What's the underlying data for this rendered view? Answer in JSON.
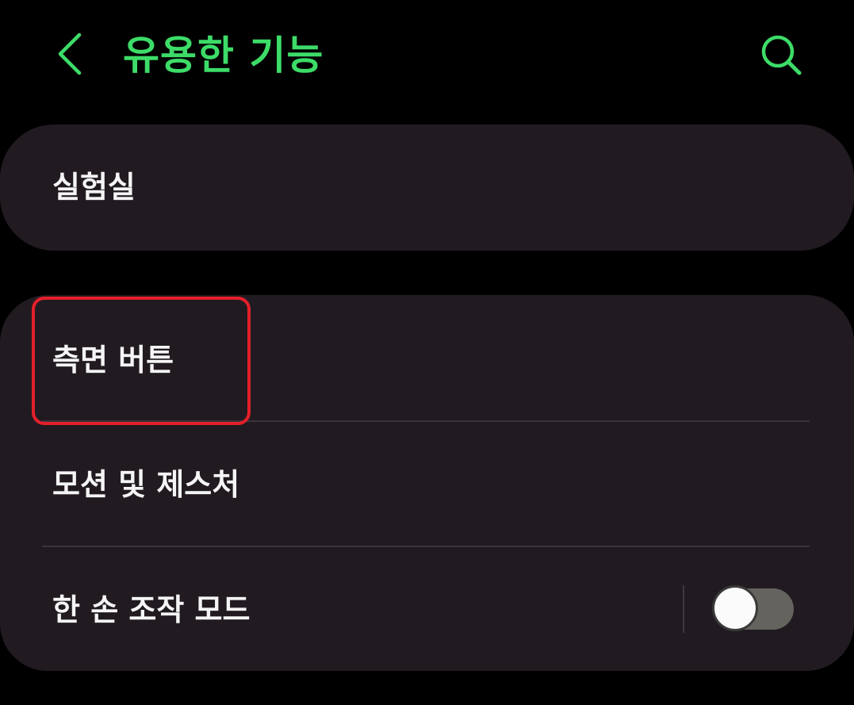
{
  "header": {
    "title": "유용한 기능",
    "back_icon": "chevron-left-icon",
    "search_icon": "search-icon",
    "accent_color": "#3ddc68"
  },
  "cards": {
    "lab": {
      "label": "실험실"
    },
    "main": {
      "items": [
        {
          "label": "측면 버튼",
          "highlighted": true
        },
        {
          "label": "모션 및 제스처"
        },
        {
          "label": "한 손 조작 모드",
          "toggle": {
            "state": "off"
          }
        }
      ]
    }
  },
  "highlight_color": "#e3202a",
  "card_background": "#211b21"
}
